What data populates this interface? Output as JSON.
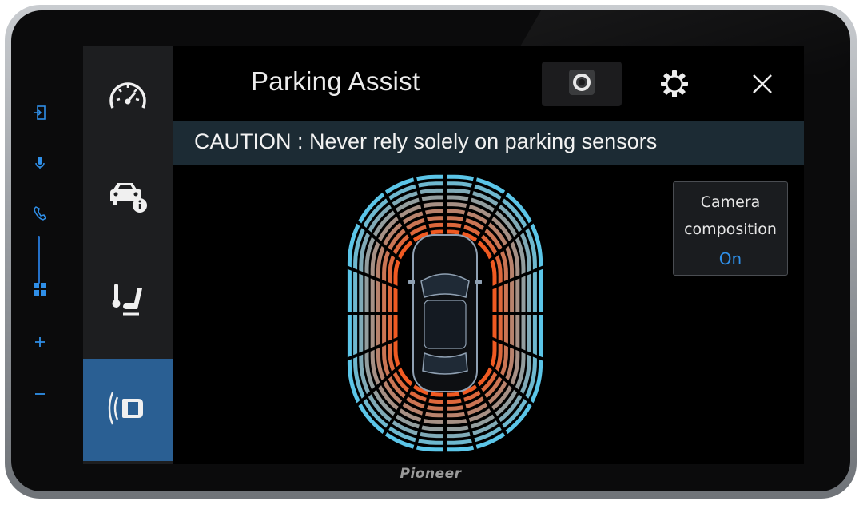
{
  "header": {
    "title": "Parking Assist",
    "camera_button_icon": "camera-icon",
    "settings_button_icon": "gear-icon",
    "close_button_icon": "close-icon"
  },
  "caution": {
    "text": "CAUTION : Never rely solely on parking sensors"
  },
  "sidebar": {
    "items": [
      {
        "icon": "speedometer-icon",
        "active": false
      },
      {
        "icon": "car-info-icon",
        "active": false
      },
      {
        "icon": "seat-heater-icon",
        "active": false
      },
      {
        "icon": "parking-sensor-icon",
        "active": true
      }
    ]
  },
  "camera_composition": {
    "label_line1": "Camera",
    "label_line2": "composition",
    "value": "On"
  },
  "hardware_keys": {
    "icons": [
      "source-icon",
      "microphone-icon",
      "phone-icon",
      "menu-grid-icon",
      "volume-up-icon",
      "volume-down-icon"
    ]
  },
  "brand": "Pioneer",
  "colors": {
    "accent": "#2f8fe8",
    "active_tab": "#2a5f93",
    "sensor_near": "#f05a22",
    "sensor_far": "#5bc5e8",
    "caution_bar": "#1c2b34"
  }
}
